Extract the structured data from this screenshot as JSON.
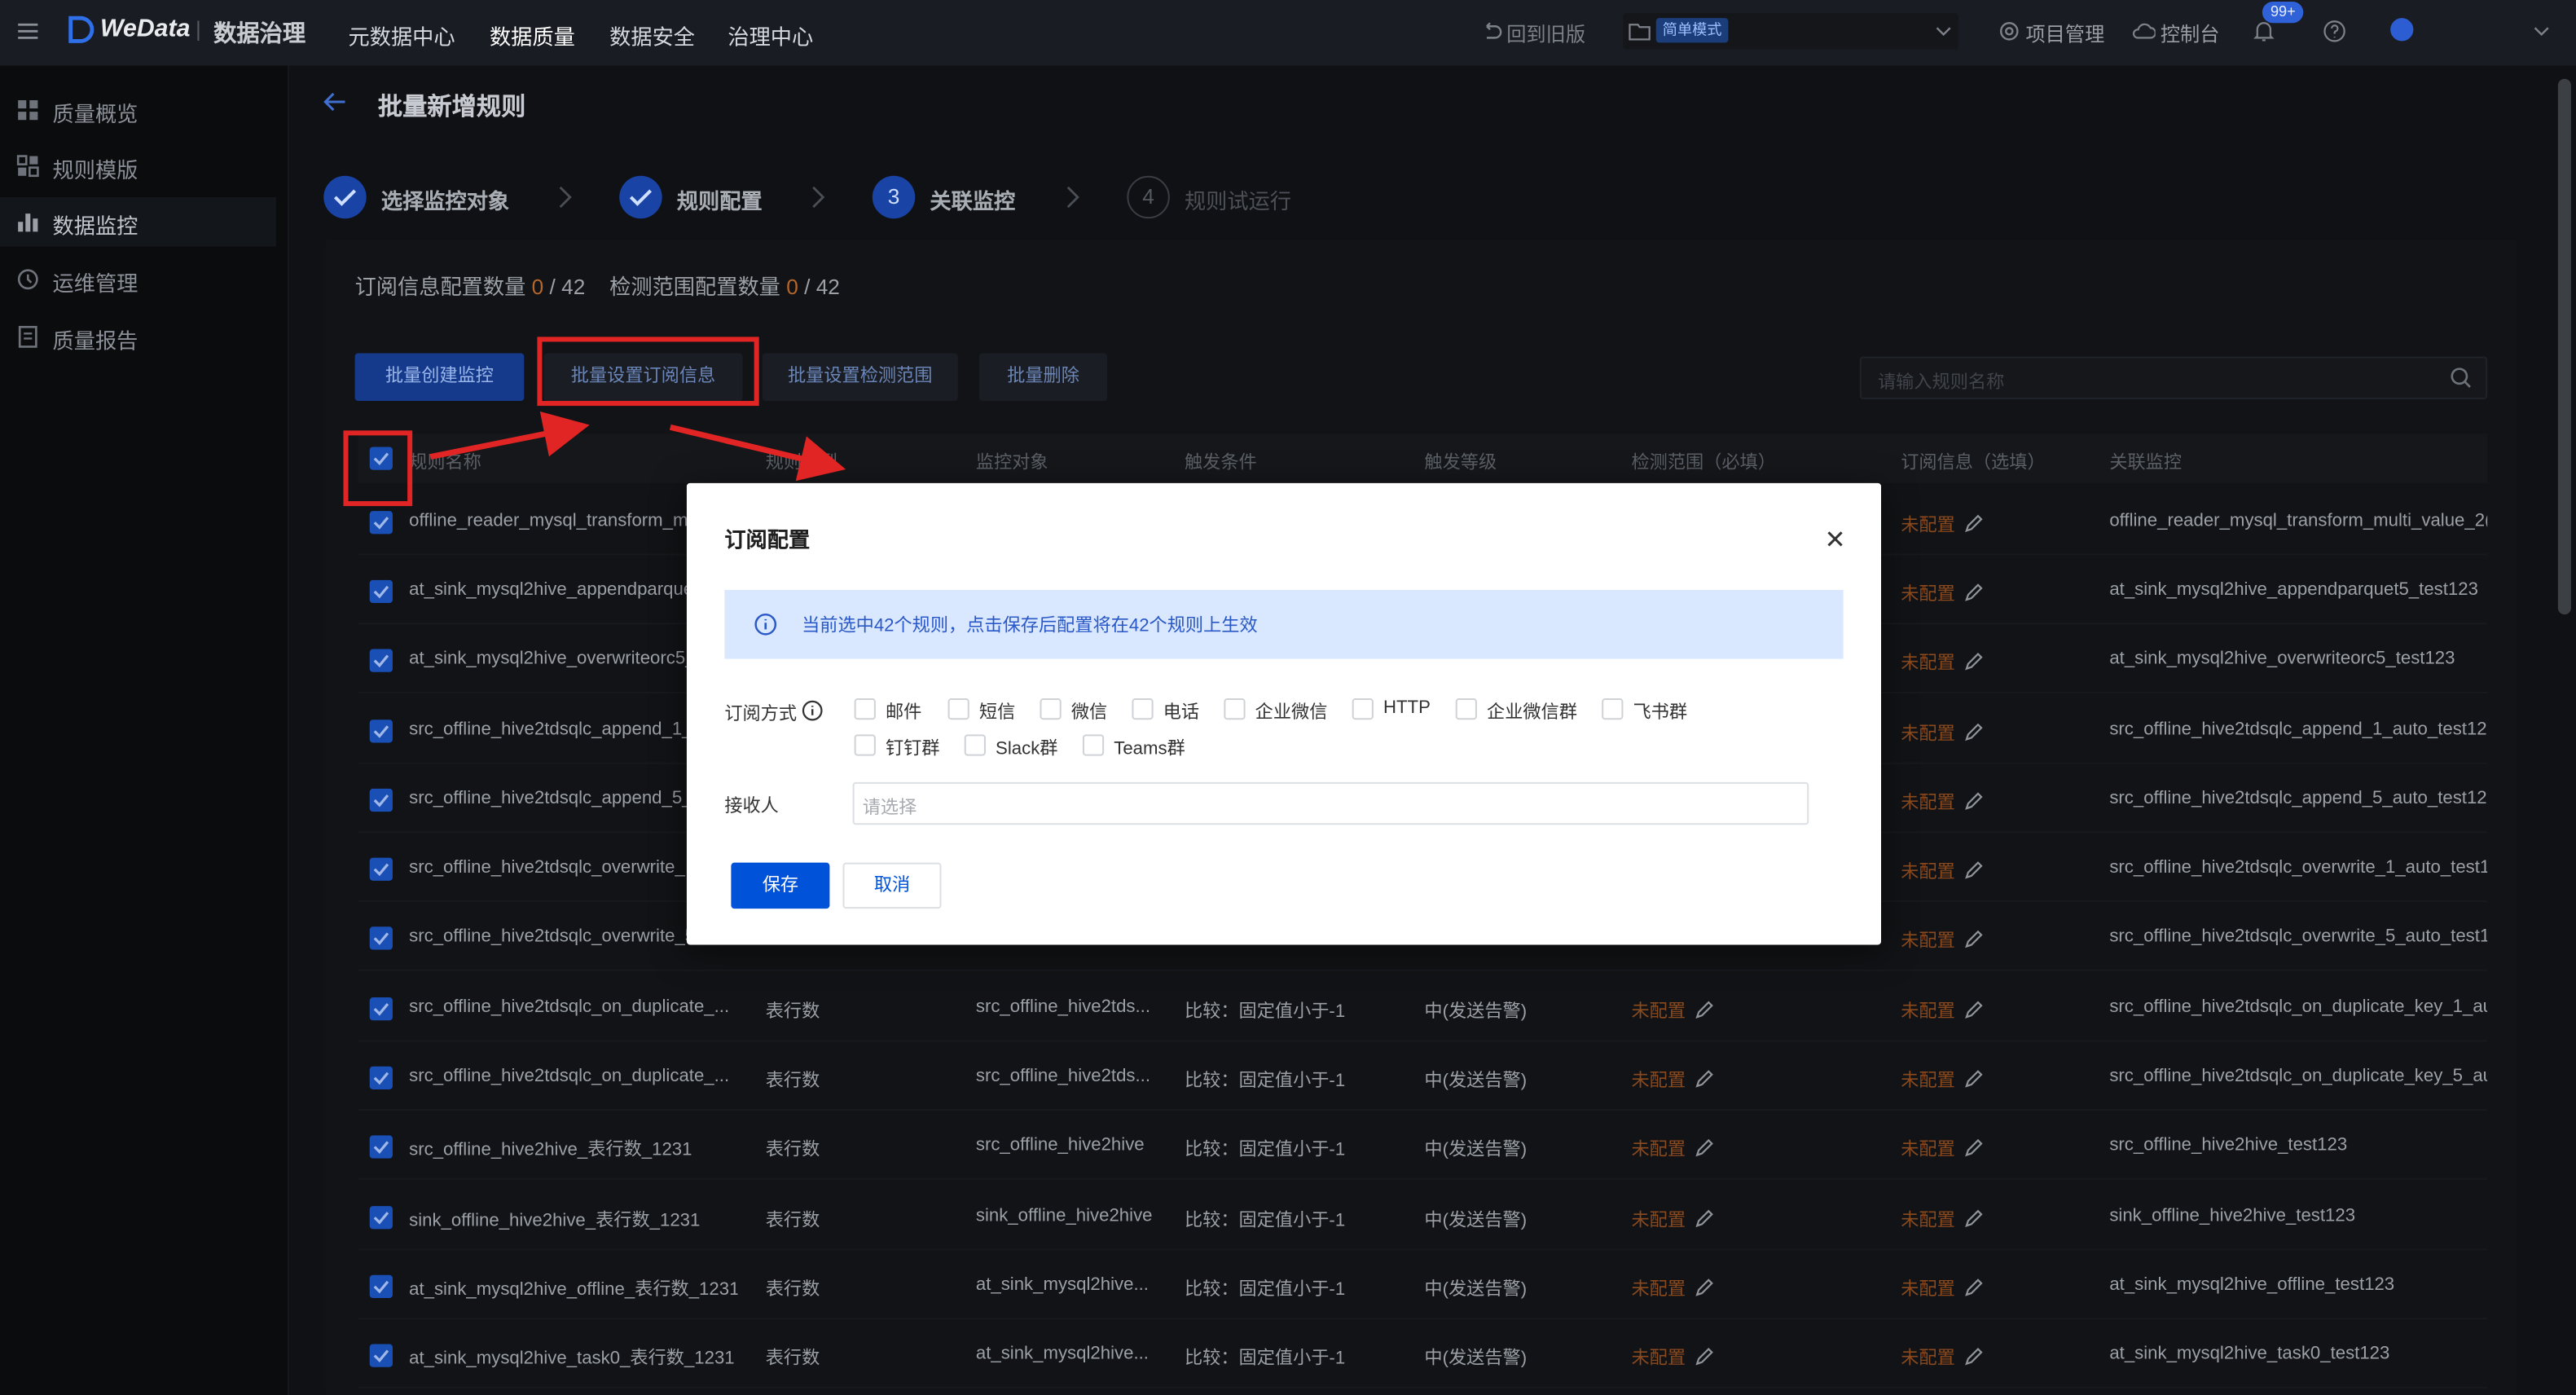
{
  "topbar": {
    "brand": "WeData",
    "product": "数据治理",
    "nav": [
      "元数据中心",
      "数据质量",
      "数据安全",
      "治理中心"
    ],
    "back_old": "回到旧版",
    "mode_tag": "简单模式",
    "project_mgmt": "项目管理",
    "console": "控制台",
    "notif_badge": "99+"
  },
  "sidebar": {
    "items": [
      {
        "label": "质量概览",
        "icon": "dashboard-icon"
      },
      {
        "label": "规则模版",
        "icon": "template-icon"
      },
      {
        "label": "数据监控",
        "icon": "bar-chart-icon"
      },
      {
        "label": "运维管理",
        "icon": "ops-icon"
      },
      {
        "label": "质量报告",
        "icon": "report-icon"
      }
    ]
  },
  "page": {
    "title": "批量新增规则",
    "steps": [
      {
        "label": "选择监控对象",
        "state": "done"
      },
      {
        "label": "规则配置",
        "state": "done"
      },
      {
        "num": "3",
        "label": "关联监控",
        "state": "active"
      },
      {
        "num": "4",
        "label": "规则试运行",
        "state": "todo"
      }
    ],
    "counts": {
      "sub_label": "订阅信息配置数量",
      "sub_num": "0",
      "sub_total": "/ 42",
      "scope_label": "检测范围配置数量",
      "scope_num": "0",
      "scope_total": "/ 42"
    },
    "buttons": {
      "create": "批量创建监控",
      "set_sub": "批量设置订阅信息",
      "set_scope": "批量设置检测范围",
      "delete": "批量删除"
    },
    "search_placeholder": "请输入规则名称"
  },
  "table": {
    "headers": [
      "规则名称",
      "规则类型",
      "监控对象",
      "触发条件",
      "触发等级",
      "检测范围（必填）",
      "订阅信息（选填）",
      "关联监控"
    ],
    "not_configured": "未配置",
    "rows": [
      {
        "name": "offline_reader_mysql_transform_m",
        "link": "offline_reader_mysql_transform_multi_value_2("
      },
      {
        "name": "at_sink_mysql2hive_appendparque",
        "link": "at_sink_mysql2hive_appendparquet5_test123"
      },
      {
        "name": "at_sink_mysql2hive_overwriteorc5_",
        "link": "at_sink_mysql2hive_overwriteorc5_test123"
      },
      {
        "name": "src_offline_hive2tdsqlc_append_1_",
        "link": "src_offline_hive2tdsqlc_append_1_auto_test12"
      },
      {
        "name": "src_offline_hive2tdsqlc_append_5_",
        "link": "src_offline_hive2tdsqlc_append_5_auto_test12"
      },
      {
        "name": "src_offline_hive2tdsqlc_overwrite_",
        "link": "src_offline_hive2tdsqlc_overwrite_1_auto_test1"
      },
      {
        "name": "src_offline_hive2tdsqlc_overwrite_5",
        "link": "src_offline_hive2tdsqlc_overwrite_5_auto_test1"
      },
      {
        "name": "src_offline_hive2tdsqlc_on_duplicate_...",
        "type": "表行数",
        "target": "src_offline_hive2tds...",
        "cond": "比较：固定值小于-1",
        "level": "中(发送告警)",
        "link": "src_offline_hive2tdsqlc_on_duplicate_key_1_au"
      },
      {
        "name": "src_offline_hive2tdsqlc_on_duplicate_...",
        "type": "表行数",
        "target": "src_offline_hive2tds...",
        "cond": "比较：固定值小于-1",
        "level": "中(发送告警)",
        "link": "src_offline_hive2tdsqlc_on_duplicate_key_5_au"
      },
      {
        "name": "src_offline_hive2hive_表行数_1231",
        "type": "表行数",
        "target": "src_offline_hive2hive",
        "cond": "比较：固定值小于-1",
        "level": "中(发送告警)",
        "link": "src_offline_hive2hive_test123"
      },
      {
        "name": "sink_offline_hive2hive_表行数_1231",
        "type": "表行数",
        "target": "sink_offline_hive2hive",
        "cond": "比较：固定值小于-1",
        "level": "中(发送告警)",
        "link": "sink_offline_hive2hive_test123"
      },
      {
        "name": "at_sink_mysql2hive_offline_表行数_1231",
        "type": "表行数",
        "target": "at_sink_mysql2hive...",
        "cond": "比较：固定值小于-1",
        "level": "中(发送告警)",
        "link": "at_sink_mysql2hive_offline_test123"
      },
      {
        "name": "at_sink_mysql2hive_task0_表行数_1231",
        "type": "表行数",
        "target": "at_sink_mysql2hive...",
        "cond": "比较：固定值小于-1",
        "level": "中(发送告警)",
        "link": "at_sink_mysql2hive_task0_test123"
      }
    ]
  },
  "dialog": {
    "title": "订阅配置",
    "info": "当前选中42个规则，点击保存后配置将在42个规则上生效",
    "method_label": "订阅方式",
    "methods": [
      "邮件",
      "短信",
      "微信",
      "电话",
      "企业微信",
      "HTTP",
      "企业微信群",
      "飞书群",
      "钉钉群",
      "Slack群",
      "Teams群"
    ],
    "receiver_label": "接收人",
    "receiver_placeholder": "请选择",
    "save": "保存",
    "cancel": "取消"
  },
  "colors": {
    "accent": "#0052d9",
    "annotation_red": "#e12424",
    "warning": "#b5662a"
  }
}
